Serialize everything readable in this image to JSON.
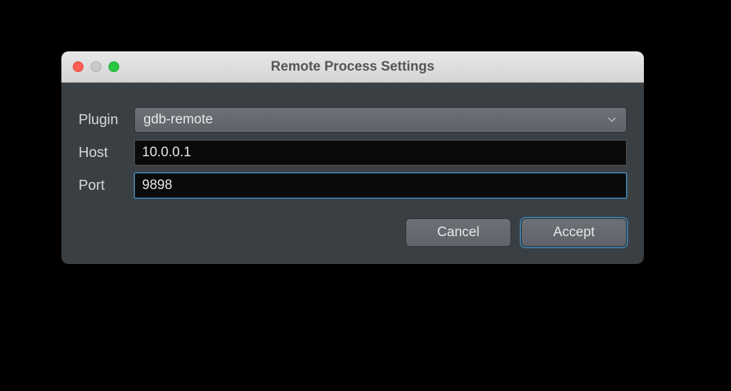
{
  "dialog": {
    "title": "Remote Process Settings",
    "fields": {
      "plugin": {
        "label": "Plugin",
        "value": "gdb-remote"
      },
      "host": {
        "label": "Host",
        "value": "10.0.0.1"
      },
      "port": {
        "label": "Port",
        "value": "9898"
      }
    },
    "buttons": {
      "cancel": "Cancel",
      "accept": "Accept"
    }
  }
}
